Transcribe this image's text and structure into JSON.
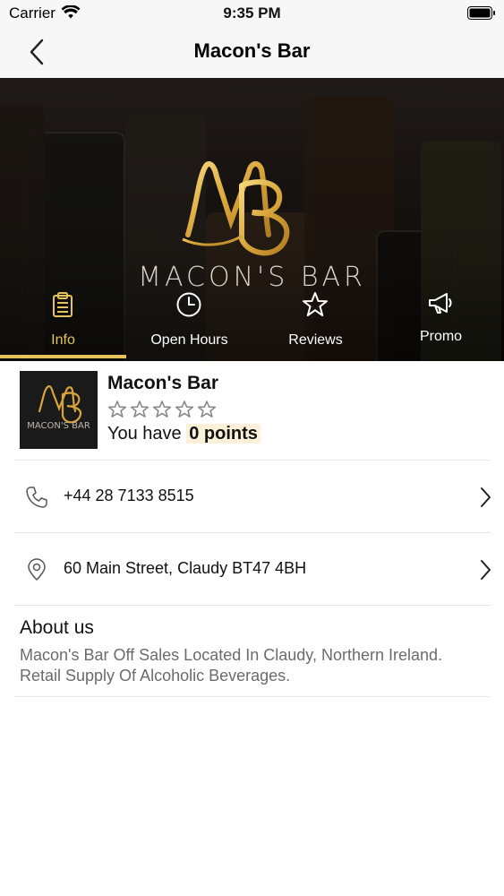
{
  "status_bar": {
    "carrier": "Carrier",
    "time": "9:35 PM"
  },
  "nav": {
    "title": "Macon's Bar",
    "back_icon": "chevron-left-icon"
  },
  "hero": {
    "logo_monogram": "MB",
    "logo_text": "MACON'S BAR"
  },
  "tabs": [
    {
      "label": "Info",
      "icon": "clipboard-icon",
      "active": true
    },
    {
      "label": "Open Hours",
      "icon": "clock-icon",
      "active": false
    },
    {
      "label": "Reviews",
      "icon": "star-icon",
      "active": false
    },
    {
      "label": "Promo",
      "icon": "megaphone-icon",
      "active": false
    }
  ],
  "profile": {
    "name": "Macon's Bar",
    "thumb_text": "MACON'S BAR",
    "rating_stars_filled": 0,
    "rating_stars_total": 5,
    "points_prefix": "You have",
    "points_value": "0 points"
  },
  "contact": {
    "phone": "+44 28 7133 8515",
    "address": "60 Main Street, Claudy BT47 4BH"
  },
  "about": {
    "title": "About us",
    "body": "Macon's Bar Off Sales Located In Claudy, Northern Ireland. Retail Supply Of Alcoholic Beverages."
  },
  "colors": {
    "accent": "#e6c25a",
    "points_highlight": "#fbf0d8",
    "muted_text": "#6b6b6b"
  }
}
